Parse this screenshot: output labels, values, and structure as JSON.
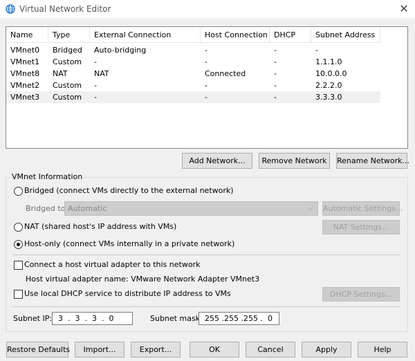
{
  "window": {
    "title": "Virtual Network Editor",
    "icon": "globe-icon",
    "close_glyph": "✕"
  },
  "table": {
    "columns": [
      "Name",
      "Type",
      "External Connection",
      "Host Connection",
      "DHCP",
      "Subnet Address"
    ],
    "rows": [
      {
        "name": "VMnet0",
        "type": "Bridged",
        "external": "Auto-bridging",
        "host": "-",
        "dhcp": "-",
        "subnet": "-"
      },
      {
        "name": "VMnet1",
        "type": "Custom",
        "external": "-",
        "host": "-",
        "dhcp": "-",
        "subnet": "1.1.1.0"
      },
      {
        "name": "VMnet8",
        "type": "NAT",
        "external": "NAT",
        "host": "Connected",
        "dhcp": "-",
        "subnet": "10.0.0.0"
      },
      {
        "name": "VMnet2",
        "type": "Custom",
        "external": "-",
        "host": "-",
        "dhcp": "-",
        "subnet": "2.2.2.0"
      },
      {
        "name": "VMnet3",
        "type": "Custom",
        "external": "-",
        "host": "-",
        "dhcp": "-",
        "subnet": "3.3.3.0"
      }
    ],
    "selected_row": 4
  },
  "table_buttons": {
    "add": "Add Network...",
    "remove": "Remove Network",
    "rename": "Rename Network..."
  },
  "vmnet_info": {
    "group_label": "VMnet Information",
    "bridged_label": "Bridged (connect VMs directly to the external network)",
    "bridged_to_label": "Bridged to:",
    "bridged_to_value": "Automatic",
    "auto_settings": "Automatic Settings...",
    "nat_label": "NAT (shared host's IP address with VMs)",
    "nat_settings": "NAT Settings...",
    "hostonly_label": "Host-only (connect VMs internally in a private network)",
    "selected_mode": "host-only",
    "connect_adapter_label": "Connect a host virtual adapter to this network",
    "connect_adapter_checked": false,
    "adapter_name_label": "Host virtual adapter name: VMware Network Adapter VMnet3",
    "dhcp_label": "Use local DHCP service to distribute IP address to VMs",
    "dhcp_checked": false,
    "dhcp_settings": "DHCP Settings...",
    "subnet_ip_label": "Subnet IP:",
    "subnet_ip_value": "3  .  3  .  3  .  0",
    "subnet_mask_label": "Subnet mask:",
    "subnet_mask_value": "255 .255 .255 .  0"
  },
  "bottom_buttons": {
    "restore": "Restore Defaults",
    "import": "Import...",
    "export": "Export...",
    "ok": "OK",
    "cancel": "Cancel",
    "apply": "Apply",
    "help": "Help"
  }
}
